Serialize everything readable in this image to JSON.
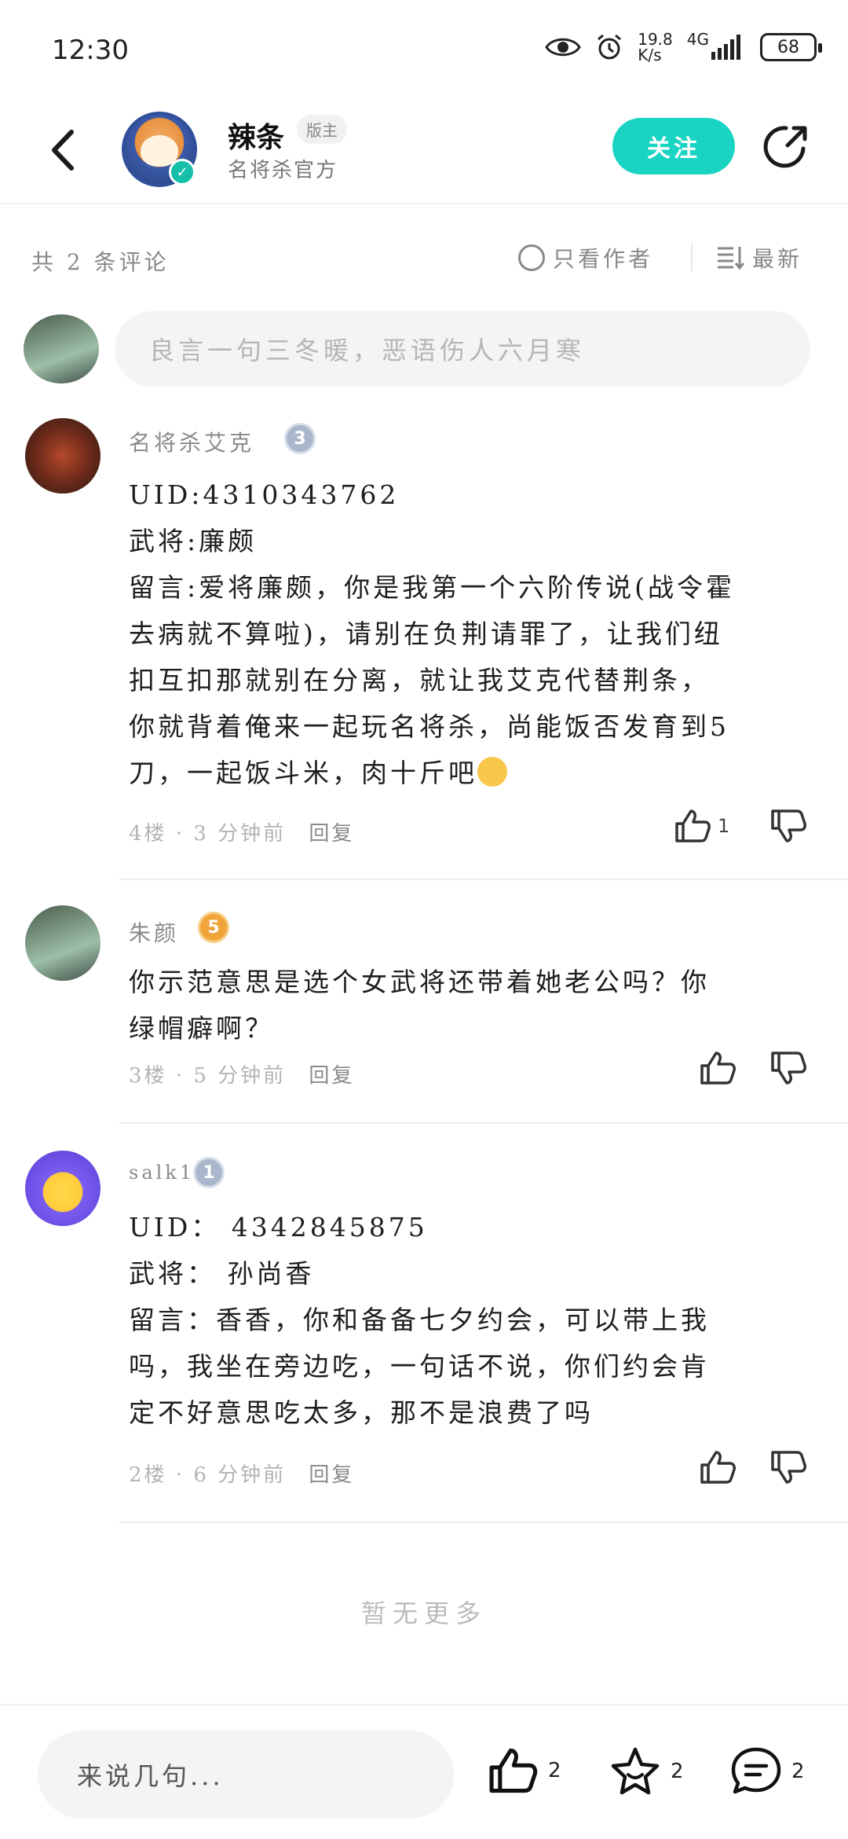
{
  "status_bar": {
    "time": "12:30",
    "net_speed_value": "19.8",
    "net_speed_unit": "K/s",
    "network": "4G",
    "battery": "68"
  },
  "header": {
    "author_name": "辣条",
    "role_badge": "版主",
    "author_subtitle": "名将杀官方",
    "follow_label": "关注",
    "accent_color": "#19d4c3"
  },
  "toolbar": {
    "comment_count": "共 2 条评论",
    "author_only_label": "只看作者",
    "sort_label": "最新"
  },
  "comment_input": {
    "placeholder": "良言一句三冬暖，恶语伤人六月寒"
  },
  "comments": [
    {
      "user": "名将杀艾克",
      "level": "3",
      "lines": [
        "UID:4310343762",
        "武将:廉颇",
        "留言:爱将廉颇，你是我第一个六阶传说(战令霍",
        "去病就不算啦)，请别在负荆请罪了，让我们纽",
        "扣互扣那就别在分离，就让我艾克代替荆条，",
        "你就背着俺来一起玩名将杀，尚能饭否发育到5",
        "刀，一起饭斗米，肉十斤吧"
      ],
      "floor": "4楼",
      "time": "· 3 分钟前",
      "reply_label": "回复",
      "likes": "1"
    },
    {
      "user": "朱颜",
      "level": "5",
      "lines": [
        "你示范意思是选个女武将还带着她老公吗？你",
        "绿帽癖啊？"
      ],
      "floor": "3楼",
      "time": "· 5 分钟前",
      "reply_label": "回复",
      "likes": ""
    },
    {
      "user": "salk1",
      "level": "1",
      "lines": [
        "UID： 4342845875",
        "武将： 孙尚香",
        "留言：香香，你和备备七夕约会，可以带上我",
        "吗，我坐在旁边吃，一句话不说，你们约会肯",
        "定不好意思吃太多，那不是浪费了吗"
      ],
      "floor": "2楼",
      "time": "· 6 分钟前",
      "reply_label": "回复",
      "likes": ""
    }
  ],
  "no_more_label": "暂无更多",
  "bottom_bar": {
    "input_placeholder": "来说几句...",
    "like_count": "2",
    "favorite_count": "2",
    "comment_count": "2"
  }
}
